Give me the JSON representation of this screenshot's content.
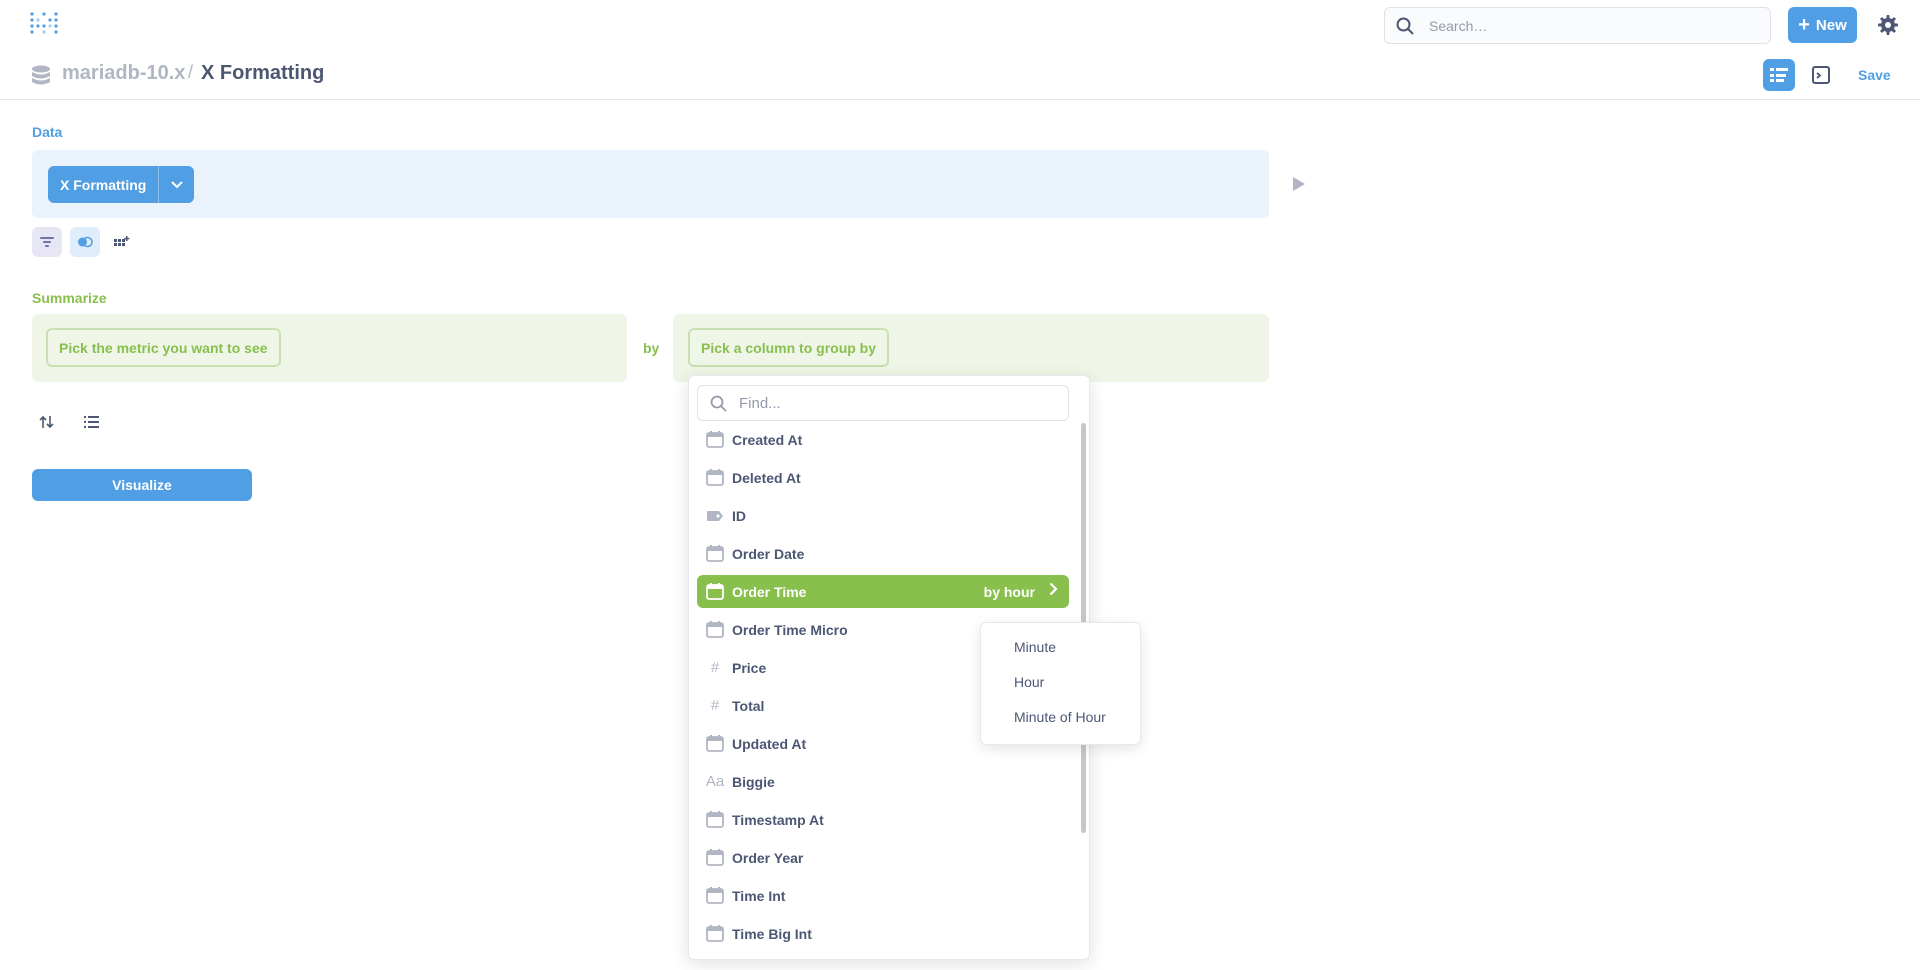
{
  "nav": {
    "search_placeholder": "Search…",
    "new_label": "New",
    "accent": "#509ee3"
  },
  "header": {
    "database": "mariadb-10.x",
    "separator": "/",
    "title": "X Formatting",
    "save_label": "Save"
  },
  "data_section": {
    "label": "Data",
    "table": "X Formatting"
  },
  "summarize": {
    "label": "Summarize",
    "metric_placeholder": "Pick the metric you want to see",
    "by": "by",
    "group_placeholder": "Pick a column to group by",
    "color": "#88bf4d"
  },
  "visualize_label": "Visualize",
  "picker": {
    "find_placeholder": "Find...",
    "columns": [
      {
        "label": "Created At",
        "icon": "calendar-icon"
      },
      {
        "label": "Deleted At",
        "icon": "calendar-icon"
      },
      {
        "label": "ID",
        "icon": "label-icon"
      },
      {
        "label": "Order Date",
        "icon": "calendar-icon"
      },
      {
        "label": "Order Time",
        "icon": "calendar-icon",
        "bucket": "by hour",
        "selected": true
      },
      {
        "label": "Order Time Micro",
        "icon": "calendar-icon"
      },
      {
        "label": "Price",
        "icon": "number-icon"
      },
      {
        "label": "Total",
        "icon": "number-icon"
      },
      {
        "label": "Updated At",
        "icon": "calendar-icon"
      },
      {
        "label": "Biggie",
        "icon": "text-icon"
      },
      {
        "label": "Timestamp At",
        "icon": "calendar-icon"
      },
      {
        "label": "Order Year",
        "icon": "calendar-icon"
      },
      {
        "label": "Time Int",
        "icon": "calendar-icon"
      },
      {
        "label": "Time Big Int",
        "icon": "calendar-icon"
      }
    ]
  },
  "bucket_menu": {
    "items": [
      "Minute",
      "Hour",
      "Minute of Hour"
    ]
  }
}
